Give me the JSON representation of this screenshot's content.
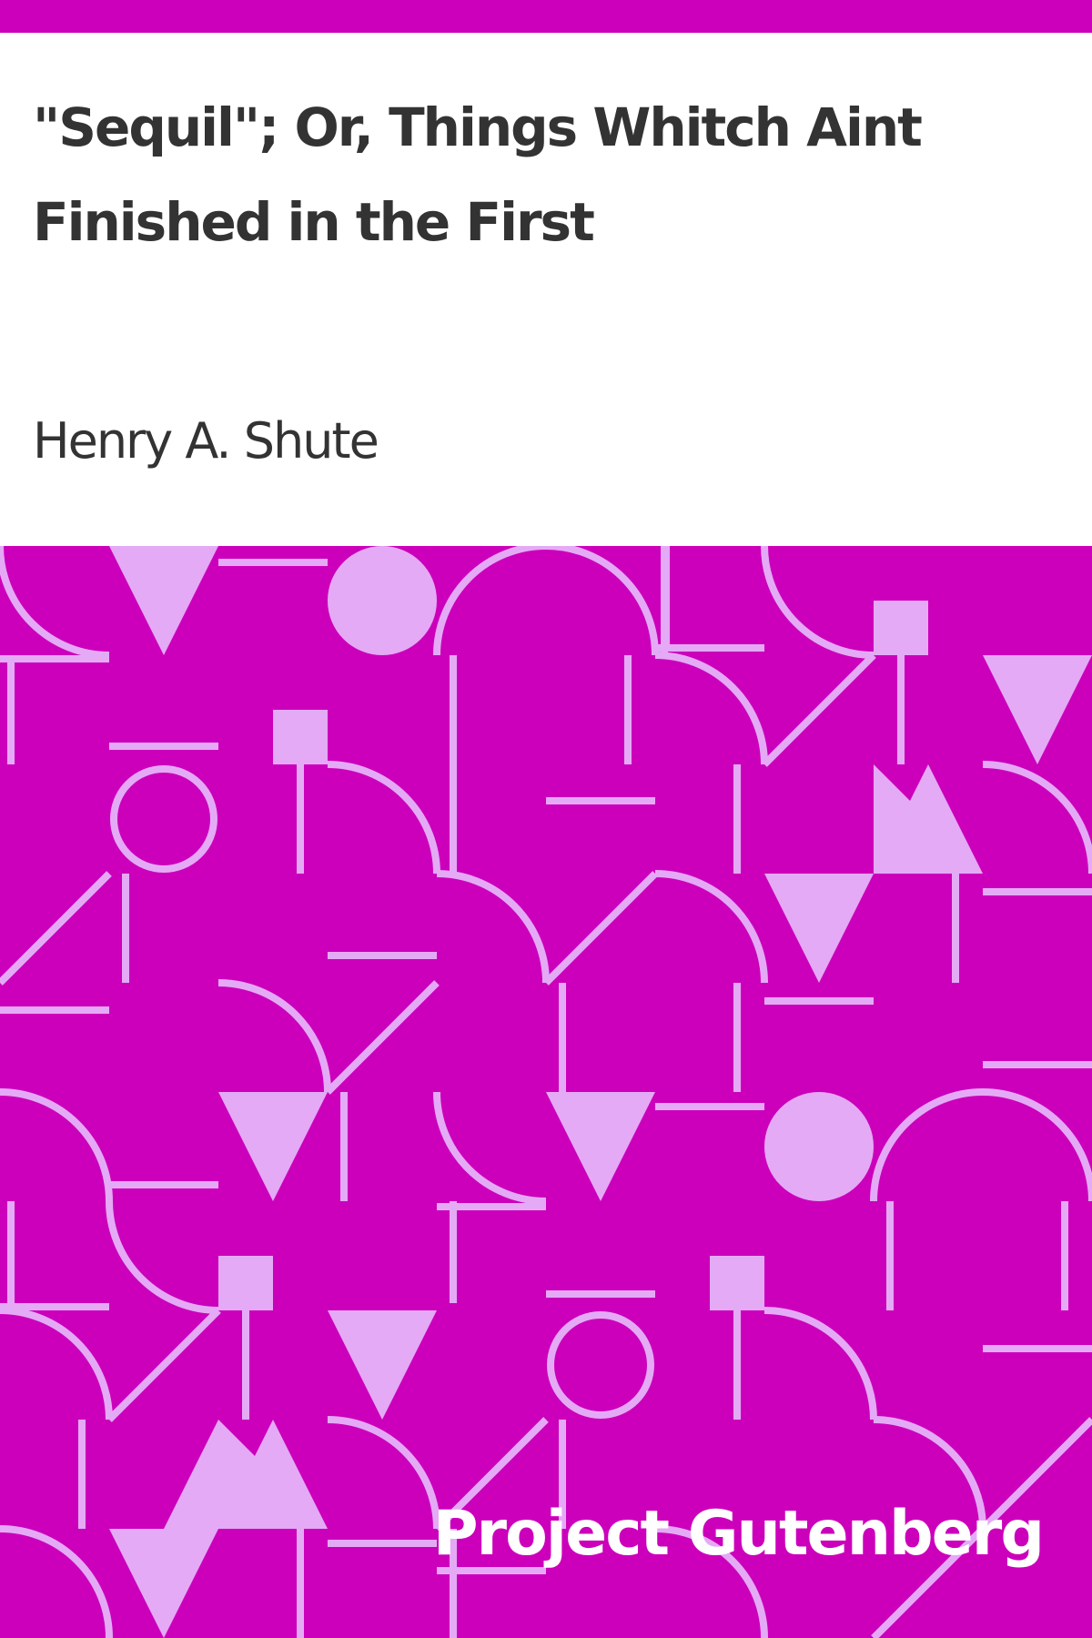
{
  "cover": {
    "title": "\"Sequil\"; Or, Things Whitch Aint Finished in the First",
    "author": "Henry A. Shute",
    "publisher": "Project Gutenberg"
  },
  "colors": {
    "brand_magenta": "#cc00bb",
    "pattern_light": "#e4aaf6",
    "title_text": "#333333",
    "publisher_text": "#ffffff"
  }
}
